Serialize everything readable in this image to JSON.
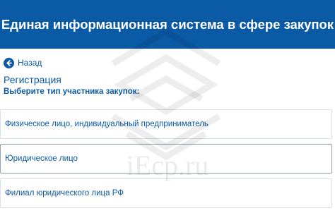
{
  "header": {
    "title": "Единая информационная система в сфере закупок"
  },
  "nav": {
    "back_label": "Назад",
    "back_icon": "arrow-left-icon"
  },
  "page": {
    "title": "Регистрация",
    "subtitle": "Выберите тип участника закупок:"
  },
  "options": [
    {
      "label": "Физическое лицо, индивидуальный предприниматель",
      "selected": false
    },
    {
      "label": "Юридическое лицо",
      "selected": true
    },
    {
      "label": "Филиал юридического лица РФ",
      "selected": false
    }
  ],
  "watermark": {
    "text": "iEcp.ru"
  },
  "colors": {
    "brand": "#0b5aa6",
    "background": "#ffffff",
    "border": "#d9dfe6"
  }
}
